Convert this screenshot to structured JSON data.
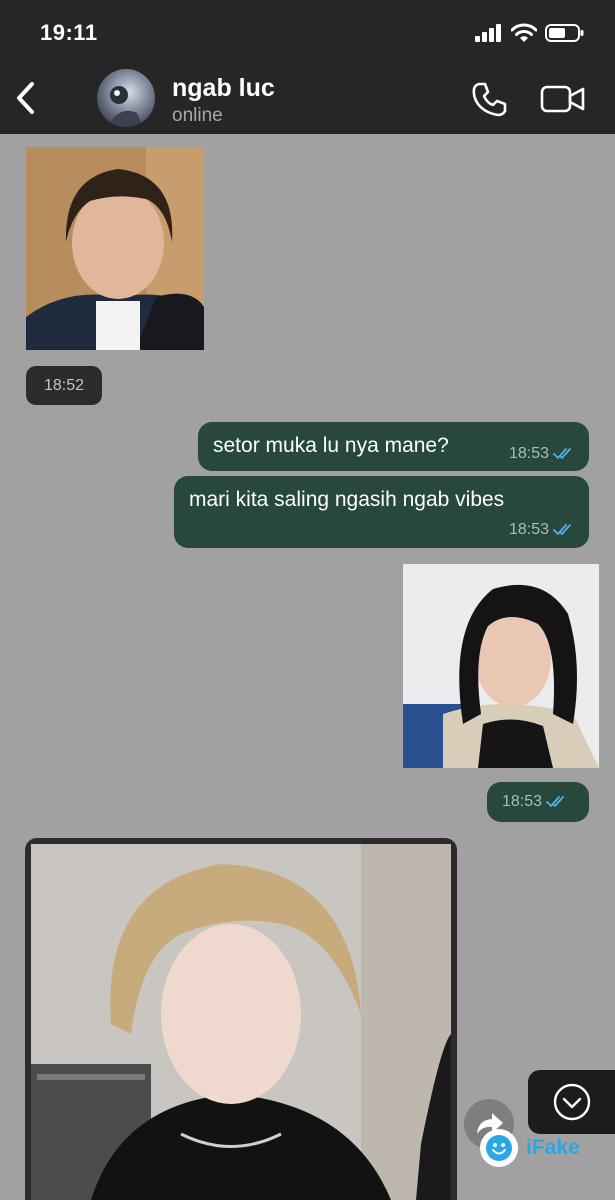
{
  "status_bar": {
    "time": "19:11"
  },
  "header": {
    "contact_name": "ngab luc",
    "contact_status": "online"
  },
  "messages": [
    {
      "direction": "incoming",
      "kind": "photo",
      "time": "18:52"
    },
    {
      "direction": "outgoing",
      "kind": "text",
      "text": "setor muka lu nya mane?",
      "time": "18:53",
      "status": "read"
    },
    {
      "direction": "outgoing",
      "kind": "text",
      "text": "mari kita saling ngasih ngab vibes",
      "time": "18:53",
      "status": "read"
    },
    {
      "direction": "outgoing",
      "kind": "photo",
      "time": "18:53",
      "status": "read"
    },
    {
      "direction": "incoming",
      "kind": "photo"
    }
  ],
  "watermark": {
    "text": "iFake"
  },
  "colors": {
    "chat_background": "#a1a1a1",
    "header_background": "#262626",
    "outgoing_bubble": "#27483a",
    "incoming_bubble": "#2b2b2b",
    "read_tick": "#4fb3e8",
    "brand": "#2aa7e8"
  },
  "icons": [
    "back-chevron-icon",
    "voice-call-icon",
    "video-call-icon",
    "read-receipt-icon",
    "scroll-down-icon",
    "forward-icon",
    "ifake-logo-icon"
  ]
}
